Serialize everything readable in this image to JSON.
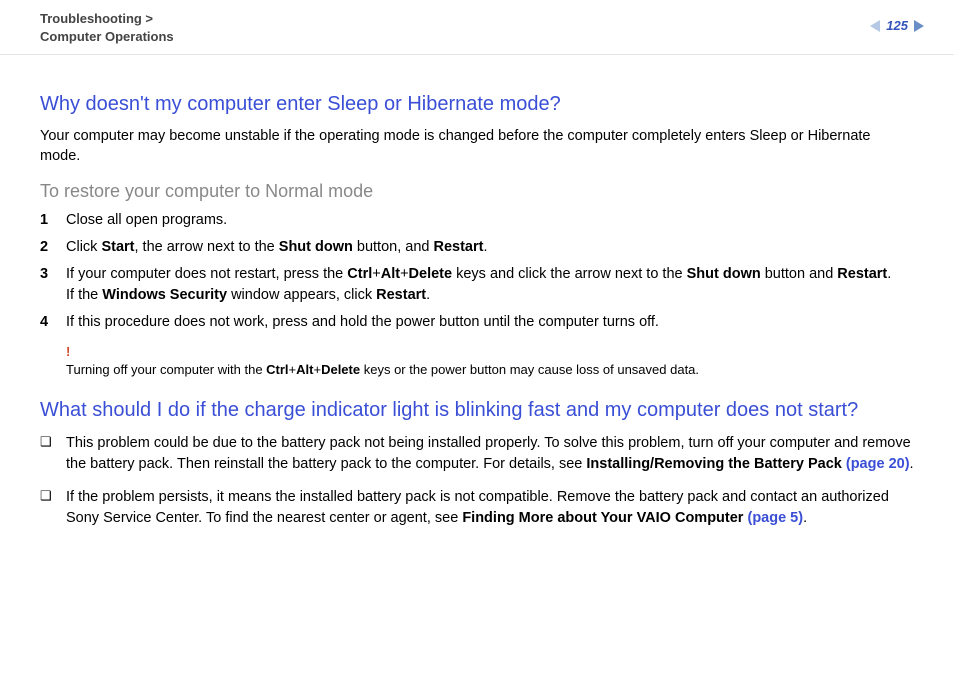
{
  "header": {
    "breadcrumb_line1": "Troubleshooting >",
    "breadcrumb_line2": "Computer Operations",
    "page_number": "125"
  },
  "section1": {
    "heading": "Why doesn't my computer enter Sleep or Hibernate mode?",
    "intro": "Your computer may become unstable if the operating mode is changed before the computer completely enters Sleep or Hibernate mode.",
    "subheading": "To restore your computer to Normal mode",
    "steps": {
      "s1_num": "1",
      "s1_text": "Close all open programs.",
      "s2_num": "2",
      "s2_pre": "Click ",
      "s2_b1": "Start",
      "s2_mid1": ", the arrow next to the ",
      "s2_b2": "Shut down",
      "s2_mid2": " button, and ",
      "s2_b3": "Restart",
      "s2_end": ".",
      "s3_num": "3",
      "s3_pre": "If your computer does not restart, press the ",
      "s3_b1": "Ctrl",
      "s3_plus1": "+",
      "s3_b2": "Alt",
      "s3_plus2": "+",
      "s3_b3": "Delete",
      "s3_mid1": " keys and click the arrow next to the ",
      "s3_b4": "Shut down",
      "s3_mid2": " button and ",
      "s3_b5": "Restart",
      "s3_dot": ".",
      "s3_line2_pre": "If the ",
      "s3_line2_b": "Windows Security",
      "s3_line2_mid": " window appears, click ",
      "s3_line2_b2": "Restart",
      "s3_line2_end": ".",
      "s4_num": "4",
      "s4_text": "If this procedure does not work, press and hold the power button until the computer turns off."
    },
    "warning": {
      "mark": "!",
      "pre": "Turning off your computer with the ",
      "b1": "Ctrl",
      "plus1": "+",
      "b2": "Alt",
      "plus2": "+",
      "b3": "Delete",
      "post": " keys or the power button may cause loss of unsaved data."
    }
  },
  "section2": {
    "heading": "What should I do if the charge indicator light is blinking fast and my computer does not start?",
    "bullets": {
      "b1_pre": "This problem could be due to the battery pack not being installed properly. To solve this problem, turn off your computer and remove the battery pack. Then reinstall the battery pack to the computer. For details, see ",
      "b1_bold": "Installing/Removing the Battery Pack ",
      "b1_link": "(page 20)",
      "b1_end": ".",
      "b2_pre": "If the problem persists, it means the installed battery pack is not compatible. Remove the battery pack and contact an authorized Sony Service Center. To find the nearest center or agent, see ",
      "b2_bold": "Finding More about Your VAIO Computer ",
      "b2_link": "(page 5)",
      "b2_end": "."
    }
  }
}
